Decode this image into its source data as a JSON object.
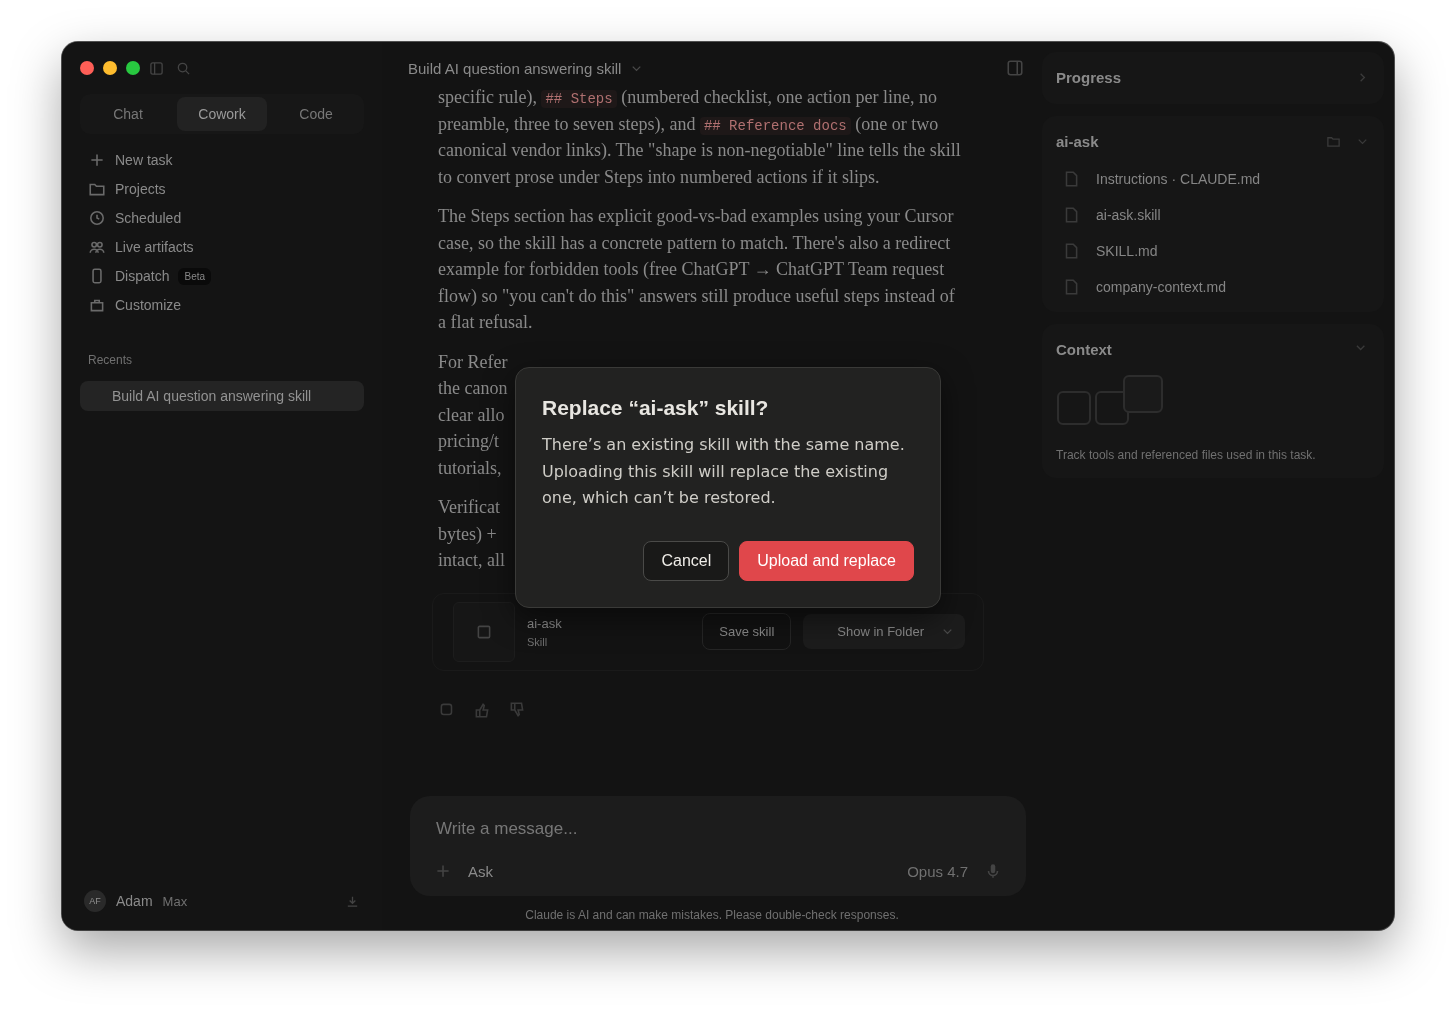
{
  "window": {
    "title": "Build AI question answering skill"
  },
  "sidebar": {
    "modes": [
      {
        "label": "Chat",
        "selected": false
      },
      {
        "label": "Cowork",
        "selected": true
      },
      {
        "label": "Code",
        "selected": false
      }
    ],
    "nav": [
      {
        "label": "New task",
        "kind": "plus"
      },
      {
        "label": "Projects",
        "kind": "folder"
      },
      {
        "label": "Scheduled",
        "kind": "clock"
      },
      {
        "label": "Live artifacts",
        "kind": "people"
      },
      {
        "label": "Dispatch",
        "kind": "phone",
        "badge": "Beta"
      },
      {
        "label": "Customize",
        "kind": "bag"
      }
    ],
    "recents_heading": "Recents",
    "recents": [
      {
        "label": "Build AI question answering skill",
        "selected": true
      }
    ],
    "user": {
      "initials": "AF",
      "name": "Adam",
      "plan": "Max"
    }
  },
  "conversation": {
    "paragraphs": [
      [
        {
          "kind": "text",
          "text": "specific rule), "
        },
        {
          "kind": "code",
          "text": "## Steps"
        },
        {
          "kind": "text",
          "text": " (numbered checklist, one action per line, no preamble, three to seven steps), and "
        },
        {
          "kind": "code",
          "text": "## Reference docs"
        },
        {
          "kind": "text",
          "text": " (one or two canonical vendor links). The \"shape is non-negotiable\" line tells the skill to convert prose under Steps into numbered actions if it slips."
        }
      ],
      [
        {
          "kind": "text",
          "text": "The Steps section has explicit good-vs-bad examples using your Cursor case, so the skill has a concrete pattern to match. There's also a redirect example for forbidden tools (free ChatGPT → ChatGPT Team request flow) so \"you can't do this\" answers still produce useful steps instead of a flat refusal."
        }
      ]
    ],
    "covered": [
      [
        "For Refer",
        "the canon",
        "clear allo",
        "pricing/t",
        "tutorials,"
      ],
      [
        "Verificat",
        "bytes) +",
        "intact, all"
      ]
    ],
    "artifact": {
      "name": "ai-ask",
      "type": "Skill",
      "save": "Save skill",
      "show": "Show in Folder"
    },
    "composer": {
      "placeholder": "Write a message...",
      "mode": "Ask",
      "model": "Opus 4.7"
    },
    "disclaimer": "Claude is AI and can make mistakes. Please double-check responses."
  },
  "panel": {
    "progress": "Progress",
    "folder": {
      "title": "ai-ask",
      "files": [
        "Instructions · CLAUDE.md",
        "ai-ask.skill",
        "SKILL.md",
        "company-context.md"
      ]
    },
    "context": {
      "title": "Context",
      "note": "Track tools and referenced files used in this task."
    }
  },
  "dialog": {
    "title": "Replace “ai-ask” skill?",
    "body": "There’s an existing skill with the same name. Uploading this skill will replace the existing one, which can’t be restored.",
    "buttons": [
      {
        "label": "Cancel",
        "kind": "secondary"
      },
      {
        "label": "Upload and replace",
        "kind": "danger"
      }
    ]
  }
}
